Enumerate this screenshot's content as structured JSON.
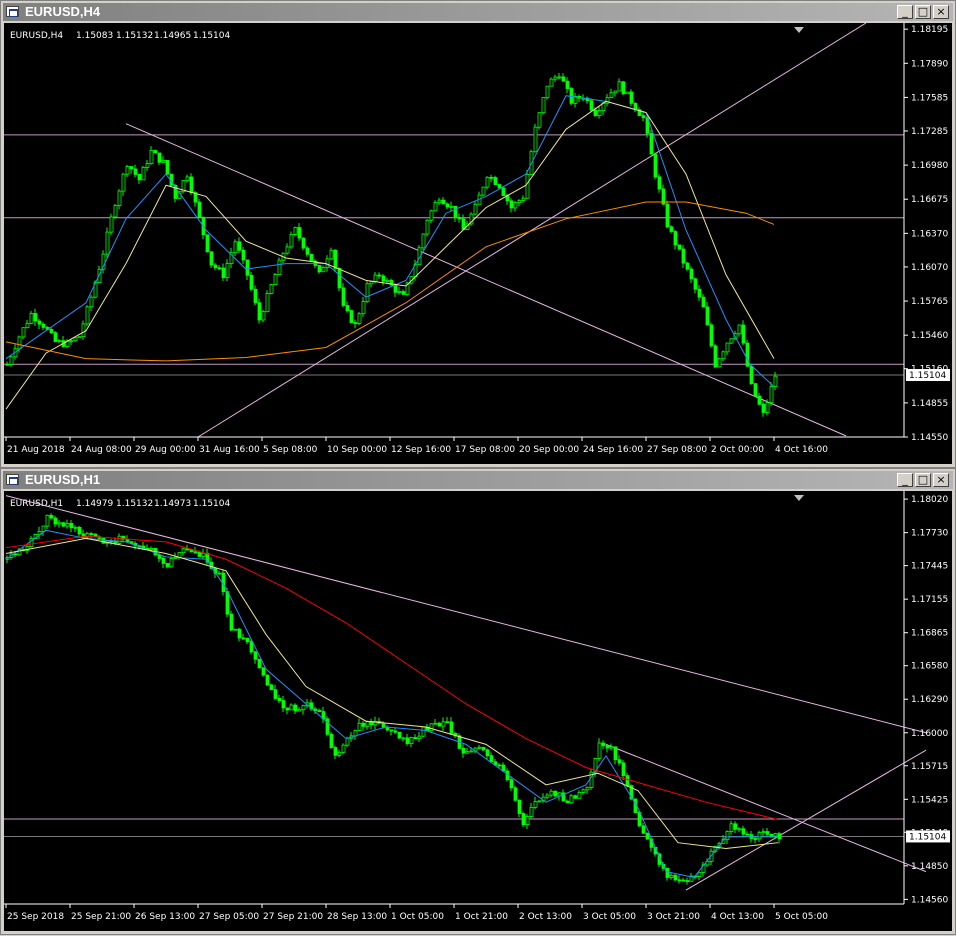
{
  "windows": [
    {
      "title": "EURUSD,H4",
      "info": {
        "symbol": "EURUSD,H4",
        "open": "1.15083",
        "high": "1.15132",
        "low": "1.14965",
        "close": "1.15104"
      },
      "buttons": [
        "_",
        "□",
        "×"
      ]
    },
    {
      "title": "EURUSD,H1",
      "info": {
        "symbol": "EURUSD,H1",
        "open": "1.14979",
        "high": "1.15132",
        "low": "1.14973",
        "close": "1.15104"
      },
      "buttons": [
        "_",
        "□",
        "×"
      ]
    }
  ],
  "colors": {
    "background": "#000000",
    "bull": "#00ff00",
    "bear": "#00ff00",
    "axis": "#ffffff",
    "hline": "#e6b6e6",
    "trendline": "#e6b6e6",
    "ma_fast": "#1e90ff",
    "ma_mid": "#f0e68c",
    "ma_slow_h4": "#ff8c00",
    "ma_slow_h1": "#ff0000",
    "price_label_bg": "#ffffff"
  },
  "chart_data": [
    {
      "type": "candlestick",
      "symbol": "EURUSD,H4",
      "ylim": [
        1.1455,
        1.1825
      ],
      "y_ticks": [
        "1.18195",
        "1.17890",
        "1.17585",
        "1.17285",
        "1.16980",
        "1.16675",
        "1.16370",
        "1.16070",
        "1.15765",
        "1.15460",
        "1.15160",
        "1.14855",
        "1.14550"
      ],
      "current_price": "1.15104",
      "x_ticks": [
        "21 Aug 2018",
        "24 Aug 08:00",
        "29 Aug 00:00",
        "31 Aug 16:00",
        "5 Sep 08:00",
        "10 Sep 00:00",
        "12 Sep 16:00",
        "17 Sep 08:00",
        "20 Sep 00:00",
        "24 Sep 16:00",
        "27 Sep 08:00",
        "2 Oct 00:00",
        "4 Oct 16:00"
      ],
      "close_path": [
        [
          0,
          1.152
        ],
        [
          3,
          1.1545
        ],
        [
          6,
          1.1565
        ],
        [
          9,
          1.1555
        ],
        [
          12,
          1.154
        ],
        [
          15,
          1.1538
        ],
        [
          18,
          1.1545
        ],
        [
          21,
          1.158
        ],
        [
          24,
          1.162
        ],
        [
          27,
          1.1665
        ],
        [
          30,
          1.17
        ],
        [
          33,
          1.1685
        ],
        [
          36,
          1.171
        ],
        [
          39,
          1.17
        ],
        [
          42,
          1.167
        ],
        [
          45,
          1.169
        ],
        [
          48,
          1.165
        ],
        [
          51,
          1.161
        ],
        [
          54,
          1.16
        ],
        [
          57,
          1.163
        ],
        [
          60,
          1.16
        ],
        [
          63,
          1.156
        ],
        [
          66,
          1.159
        ],
        [
          69,
          1.162
        ],
        [
          72,
          1.164
        ],
        [
          75,
          1.162
        ],
        [
          78,
          1.16
        ],
        [
          81,
          1.1625
        ],
        [
          84,
          1.157
        ],
        [
          87,
          1.1555
        ],
        [
          90,
          1.159
        ],
        [
          93,
          1.16
        ],
        [
          96,
          1.159
        ],
        [
          99,
          1.158
        ],
        [
          102,
          1.161
        ],
        [
          105,
          1.165
        ],
        [
          108,
          1.167
        ],
        [
          111,
          1.166
        ],
        [
          114,
          1.164
        ],
        [
          117,
          1.166
        ],
        [
          120,
          1.169
        ],
        [
          123,
          1.168
        ],
        [
          126,
          1.166
        ],
        [
          129,
          1.167
        ],
        [
          132,
          1.173
        ],
        [
          135,
          1.177
        ],
        [
          138,
          1.178
        ],
        [
          141,
          1.1755
        ],
        [
          144,
          1.176
        ],
        [
          147,
          1.1745
        ],
        [
          150,
          1.176
        ],
        [
          153,
          1.177
        ],
        [
          156,
          1.1755
        ],
        [
          159,
          1.174
        ],
        [
          162,
          1.169
        ],
        [
          165,
          1.1645
        ],
        [
          168,
          1.162
        ],
        [
          171,
          1.1595
        ],
        [
          174,
          1.157
        ],
        [
          177,
          1.152
        ],
        [
          180,
          1.154
        ],
        [
          183,
          1.1555
        ],
        [
          186,
          1.15
        ],
        [
          189,
          1.1475
        ],
        [
          192,
          1.151
        ]
      ],
      "series": [
        {
          "name": "",
          "kind": "ma_fast",
          "values": [
            [
              0,
              1.1525
            ],
            [
              20,
              1.1575
            ],
            [
              30,
              1.165
            ],
            [
              40,
              1.169
            ],
            [
              50,
              1.164
            ],
            [
              60,
              1.1605
            ],
            [
              70,
              1.161
            ],
            [
              80,
              1.161
            ],
            [
              90,
              1.158
            ],
            [
              100,
              1.1595
            ],
            [
              110,
              1.1655
            ],
            [
              120,
              1.167
            ],
            [
              130,
              1.169
            ],
            [
              140,
              1.176
            ],
            [
              150,
              1.1755
            ],
            [
              160,
              1.1745
            ],
            [
              170,
              1.164
            ],
            [
              180,
              1.156
            ],
            [
              186,
              1.152
            ],
            [
              192,
              1.15
            ]
          ]
        },
        {
          "name": "",
          "kind": "ma_mid",
          "values": [
            [
              0,
              1.148
            ],
            [
              10,
              1.153
            ],
            [
              20,
              1.155
            ],
            [
              30,
              1.161
            ],
            [
              40,
              1.168
            ],
            [
              50,
              1.167
            ],
            [
              60,
              1.163
            ],
            [
              70,
              1.1615
            ],
            [
              80,
              1.161
            ],
            [
              90,
              1.1595
            ],
            [
              100,
              1.159
            ],
            [
              110,
              1.1625
            ],
            [
              120,
              1.166
            ],
            [
              130,
              1.168
            ],
            [
              140,
              1.173
            ],
            [
              150,
              1.1755
            ],
            [
              160,
              1.1745
            ],
            [
              170,
              1.169
            ],
            [
              180,
              1.16
            ],
            [
              192,
              1.1525
            ]
          ]
        },
        {
          "name": "",
          "kind": "ma_slow",
          "values": [
            [
              0,
              1.154
            ],
            [
              20,
              1.1525
            ],
            [
              40,
              1.1523
            ],
            [
              60,
              1.1526
            ],
            [
              80,
              1.1535
            ],
            [
              100,
              1.1575
            ],
            [
              120,
              1.1625
            ],
            [
              140,
              1.165
            ],
            [
              160,
              1.1665
            ],
            [
              170,
              1.1665
            ],
            [
              185,
              1.1655
            ],
            [
              192,
              1.1645
            ]
          ]
        }
      ],
      "hlines": [
        1.1725,
        1.1651,
        1.152,
        1.15104
      ],
      "trendlines": [
        [
          [
            30,
            1.1735
          ],
          [
            210,
            1.1456
          ]
        ],
        [
          [
            48,
            1.1455
          ],
          [
            215,
            1.1825
          ]
        ]
      ]
    },
    {
      "type": "candlestick",
      "symbol": "EURUSD,H1",
      "ylim": [
        1.1452,
        1.1809
      ],
      "y_ticks": [
        "1.18020",
        "1.17730",
        "1.17445",
        "1.17155",
        "1.16865",
        "1.16580",
        "1.16290",
        "1.16000",
        "1.15715",
        "1.15425",
        "1.15140",
        "1.14850",
        "1.14560"
      ],
      "current_price": "1.15104",
      "x_ticks": [
        "25 Sep 2018",
        "25 Sep 21:00",
        "26 Sep 13:00",
        "27 Sep 05:00",
        "27 Sep 21:00",
        "28 Sep 13:00",
        "1 Oct 05:00",
        "1 Oct 21:00",
        "2 Oct 13:00",
        "3 Oct 05:00",
        "3 Oct 21:00",
        "4 Oct 13:00",
        "5 Oct 05:00"
      ],
      "close_path": [
        [
          0,
          1.175
        ],
        [
          5,
          1.176
        ],
        [
          10,
          1.1785
        ],
        [
          15,
          1.178
        ],
        [
          20,
          1.177
        ],
        [
          25,
          1.1765
        ],
        [
          30,
          1.1768
        ],
        [
          35,
          1.176
        ],
        [
          40,
          1.1745
        ],
        [
          45,
          1.176
        ],
        [
          50,
          1.175
        ],
        [
          53,
          1.1735
        ],
        [
          56,
          1.169
        ],
        [
          60,
          1.168
        ],
        [
          65,
          1.164
        ],
        [
          70,
          1.162
        ],
        [
          75,
          1.1625
        ],
        [
          78,
          1.162
        ],
        [
          82,
          1.158
        ],
        [
          86,
          1.16
        ],
        [
          90,
          1.161
        ],
        [
          95,
          1.1605
        ],
        [
          100,
          1.159
        ],
        [
          105,
          1.1605
        ],
        [
          110,
          1.161
        ],
        [
          114,
          1.158
        ],
        [
          118,
          1.1585
        ],
        [
          122,
          1.1575
        ],
        [
          126,
          1.1555
        ],
        [
          129,
          1.152
        ],
        [
          132,
          1.154
        ],
        [
          136,
          1.155
        ],
        [
          140,
          1.154
        ],
        [
          145,
          1.1555
        ],
        [
          148,
          1.159
        ],
        [
          151,
          1.1585
        ],
        [
          154,
          1.1565
        ],
        [
          157,
          1.153
        ],
        [
          161,
          1.15
        ],
        [
          165,
          1.1475
        ],
        [
          169,
          1.147
        ],
        [
          173,
          1.148
        ],
        [
          177,
          1.15
        ],
        [
          181,
          1.152
        ],
        [
          185,
          1.151
        ],
        [
          189,
          1.1513
        ],
        [
          193,
          1.151
        ]
      ],
      "series": [
        {
          "name": "",
          "kind": "ma_fast",
          "values": [
            [
              0,
              1.175
            ],
            [
              10,
              1.1775
            ],
            [
              20,
              1.1768
            ],
            [
              30,
              1.1765
            ],
            [
              40,
              1.1752
            ],
            [
              50,
              1.175
            ],
            [
              55,
              1.1725
            ],
            [
              65,
              1.1655
            ],
            [
              75,
              1.1625
            ],
            [
              85,
              1.1595
            ],
            [
              95,
              1.1605
            ],
            [
              105,
              1.1602
            ],
            [
              115,
              1.159
            ],
            [
              125,
              1.1565
            ],
            [
              135,
              1.154
            ],
            [
              145,
              1.1555
            ],
            [
              150,
              1.158
            ],
            [
              158,
              1.1535
            ],
            [
              165,
              1.148
            ],
            [
              172,
              1.1475
            ],
            [
              180,
              1.151
            ],
            [
              193,
              1.151
            ]
          ]
        },
        {
          "name": "",
          "kind": "ma_mid",
          "values": [
            [
              0,
              1.1755
            ],
            [
              20,
              1.1768
            ],
            [
              40,
              1.1755
            ],
            [
              55,
              1.174
            ],
            [
              65,
              1.1685
            ],
            [
              75,
              1.164
            ],
            [
              90,
              1.161
            ],
            [
              105,
              1.1605
            ],
            [
              120,
              1.159
            ],
            [
              135,
              1.1555
            ],
            [
              148,
              1.1565
            ],
            [
              158,
              1.155
            ],
            [
              168,
              1.1505
            ],
            [
              180,
              1.15
            ],
            [
              193,
              1.1505
            ]
          ]
        },
        {
          "name": "",
          "kind": "ma_slow",
          "values": [
            [
              0,
              1.176
            ],
            [
              20,
              1.177
            ],
            [
              40,
              1.1765
            ],
            [
              55,
              1.175
            ],
            [
              70,
              1.1725
            ],
            [
              85,
              1.1695
            ],
            [
              100,
              1.166
            ],
            [
              115,
              1.1625
            ],
            [
              130,
              1.1595
            ],
            [
              145,
              1.157
            ],
            [
              160,
              1.1555
            ],
            [
              175,
              1.154
            ],
            [
              193,
              1.1525
            ]
          ]
        }
      ],
      "hlines": [
        1.15255,
        1.15104
      ],
      "trendlines": [
        [
          [
            0,
            1.1805
          ],
          [
            230,
            1.16
          ]
        ],
        [
          [
            150,
            1.159
          ],
          [
            230,
            1.148
          ]
        ],
        [
          [
            170,
            1.1464
          ],
          [
            230,
            1.1585
          ]
        ]
      ]
    }
  ]
}
